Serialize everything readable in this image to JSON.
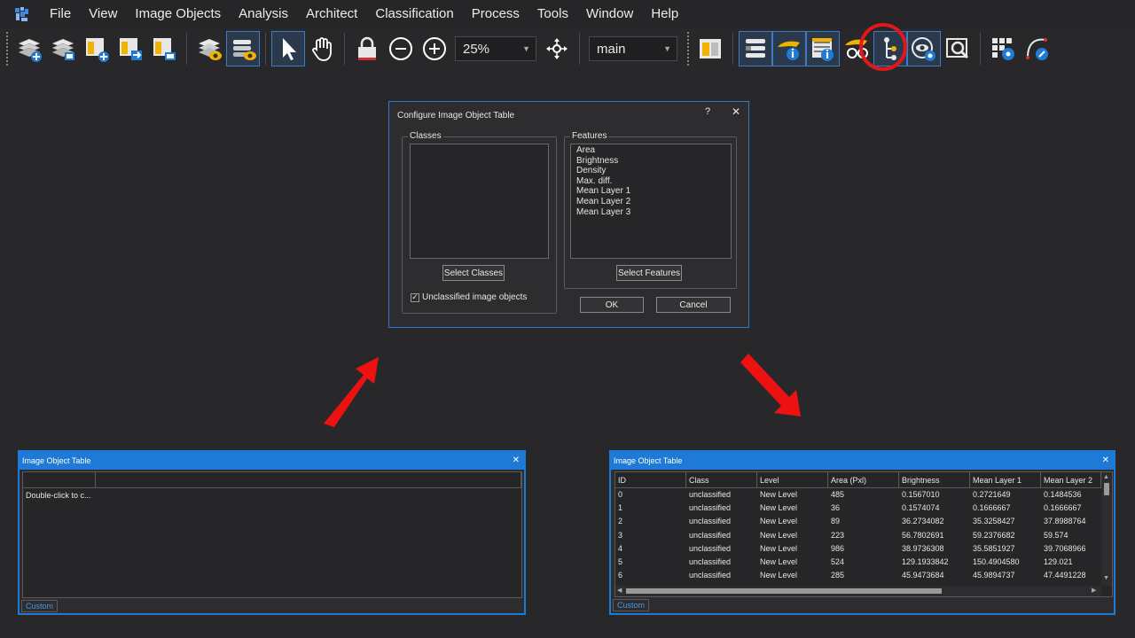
{
  "menu": {
    "items": [
      "File",
      "View",
      "Image Objects",
      "Analysis",
      "Architect",
      "Classification",
      "Process",
      "Tools",
      "Window",
      "Help"
    ]
  },
  "toolbar": {
    "zoom_value": "25%",
    "layer_value": "main"
  },
  "colors": {
    "accent": "#1e7ad6",
    "highlight_ring": "#e01818",
    "arrow": "#ee1111",
    "background": "#28282a"
  },
  "dialog": {
    "title": "Configure Image Object Table",
    "help": "?",
    "close": "✕",
    "classes_label": "Classes",
    "features_label": "Features",
    "features": [
      "Area",
      "Brightness",
      "Density",
      "Max. diff.",
      "Mean Layer 1",
      "Mean Layer 2",
      "Mean Layer 3"
    ],
    "select_classes": "Select Classes",
    "select_features": "Select Features",
    "unclassified_label": "Unclassified image objects",
    "unclassified_checked": true,
    "ok": "OK",
    "cancel": "Cancel"
  },
  "left_panel": {
    "title": "Image Object Table",
    "close": "✕",
    "hint": "Double-click to c...",
    "tab": "Custom"
  },
  "right_panel": {
    "title": "Image Object Table",
    "close": "✕",
    "tab": "Custom",
    "columns": [
      "ID",
      "Class",
      "Level",
      "Area (Pxl)",
      "Brightness",
      "Mean Layer 1",
      "Mean Layer 2"
    ],
    "rows": [
      [
        "0",
        "unclassified",
        "New Level",
        "485",
        "0.1567010",
        "0.2721649",
        "0.1484536"
      ],
      [
        "1",
        "unclassified",
        "New Level",
        "36",
        "0.1574074",
        "0.1666667",
        "0.1666667"
      ],
      [
        "2",
        "unclassified",
        "New Level",
        "89",
        "36.2734082",
        "35.3258427",
        "37.8988764"
      ],
      [
        "3",
        "unclassified",
        "New Level",
        "223",
        "56.7802691",
        "59.2376682",
        "59.574"
      ],
      [
        "4",
        "unclassified",
        "New Level",
        "986",
        "38.9736308",
        "35.5851927",
        "39.7068966"
      ],
      [
        "5",
        "unclassified",
        "New Level",
        "524",
        "129.1933842",
        "150.4904580",
        "129.021"
      ],
      [
        "6",
        "unclassified",
        "New Level",
        "285",
        "45.9473684",
        "45.9894737",
        "47.4491228"
      ]
    ]
  }
}
